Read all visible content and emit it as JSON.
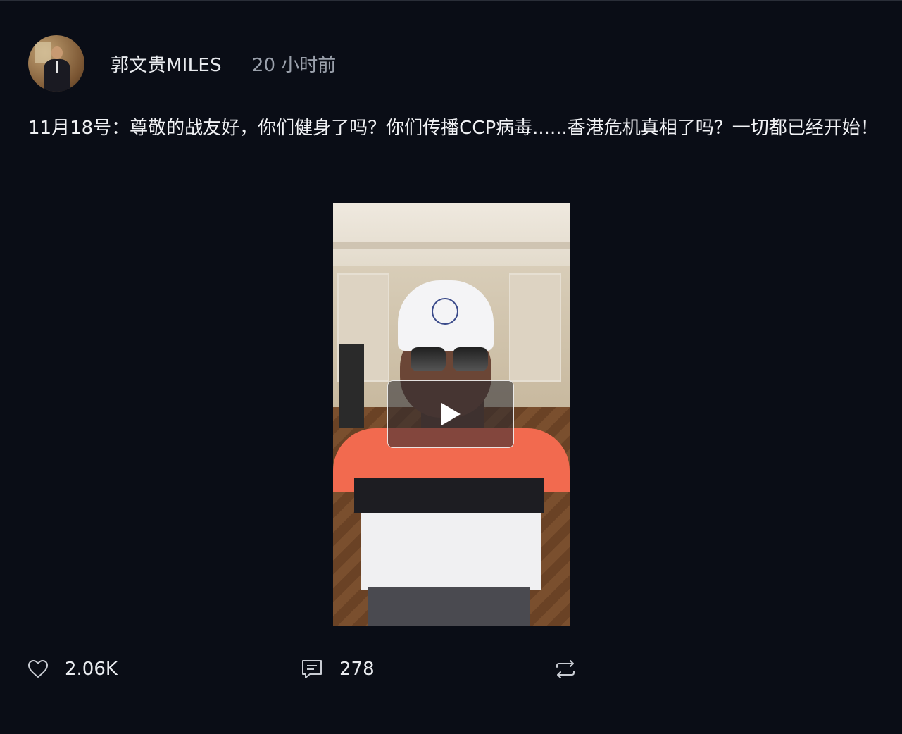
{
  "post": {
    "author": "郭文贵MILES",
    "time_ago": "20 小时前",
    "text": "11月18号：尊敬的战友好，你们健身了吗？你们传播CCP病毒......香港危机真相了吗？一切都已经开始！"
  },
  "actions": {
    "likes": "2.06K",
    "comments": "278"
  },
  "icons": {
    "like": "heart-icon",
    "comment": "comment-icon",
    "repost": "repost-icon",
    "play": "play-icon"
  }
}
